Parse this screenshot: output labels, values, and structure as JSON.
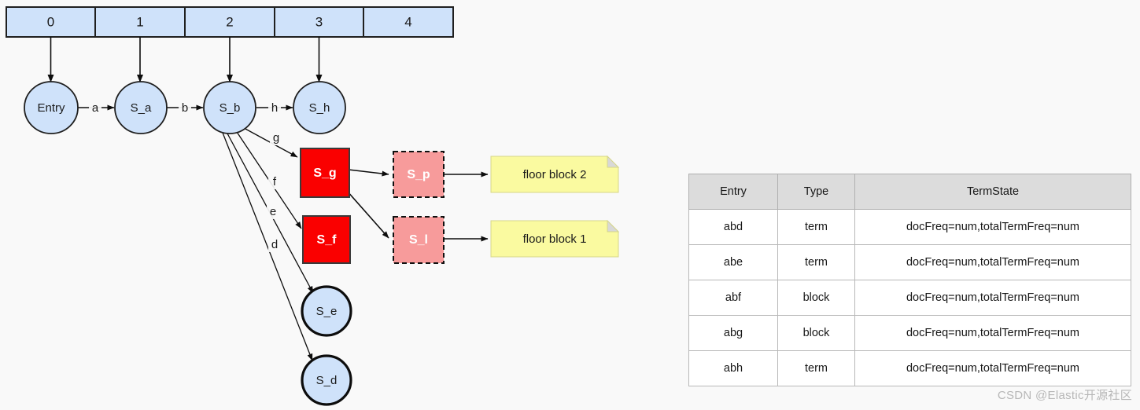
{
  "diagram": {
    "index_bar": {
      "cells": [
        {
          "label": "0"
        },
        {
          "label": "1"
        },
        {
          "label": "2"
        },
        {
          "label": "3"
        },
        {
          "label": "4"
        }
      ]
    },
    "state_nodes": [
      {
        "id": "entry",
        "label": "Entry"
      },
      {
        "id": "s_a",
        "label": "S_a"
      },
      {
        "id": "s_b",
        "label": "S_b"
      },
      {
        "id": "s_h",
        "label": "S_h"
      },
      {
        "id": "s_e",
        "label": "S_e"
      },
      {
        "id": "s_d",
        "label": "S_d"
      }
    ],
    "block_nodes": [
      {
        "id": "s_g",
        "label": "S_g"
      },
      {
        "id": "s_f",
        "label": "S_f"
      }
    ],
    "floor_nodes": [
      {
        "id": "s_p",
        "label": "S_p"
      },
      {
        "id": "s_l",
        "label": "S_l"
      }
    ],
    "notes": [
      {
        "id": "floor_block_2",
        "label": "floor block 2"
      },
      {
        "id": "floor_block_1",
        "label": "floor block 1"
      }
    ],
    "edge_labels": [
      {
        "id": "edge-a",
        "label": "a"
      },
      {
        "id": "edge-b",
        "label": "b"
      },
      {
        "id": "edge-h",
        "label": "h"
      },
      {
        "id": "edge-g",
        "label": "g"
      },
      {
        "id": "edge-f",
        "label": "f"
      },
      {
        "id": "edge-e",
        "label": "e"
      },
      {
        "id": "edge-d",
        "label": "d"
      }
    ],
    "colors": {
      "node_fill": "#cfe2fa",
      "block_fill": "#fa0000",
      "floor_fill": "#f79b9b",
      "note_fill": "#fafaa0",
      "background": "#f9f9f9"
    }
  },
  "table": {
    "headers": [
      "Entry",
      "Type",
      "TermState"
    ],
    "rows": [
      [
        "abd",
        "term",
        "docFreq=num,totalTermFreq=num"
      ],
      [
        "abe",
        "term",
        "docFreq=num,totalTermFreq=num"
      ],
      [
        "abf",
        "block",
        "docFreq=num,totalTermFreq=num"
      ],
      [
        "abg",
        "block",
        "docFreq=num,totalTermFreq=num"
      ],
      [
        "abh",
        "term",
        "docFreq=num,totalTermFreq=num"
      ]
    ]
  },
  "watermark": {
    "text": "CSDN @Elastic开源社区"
  }
}
